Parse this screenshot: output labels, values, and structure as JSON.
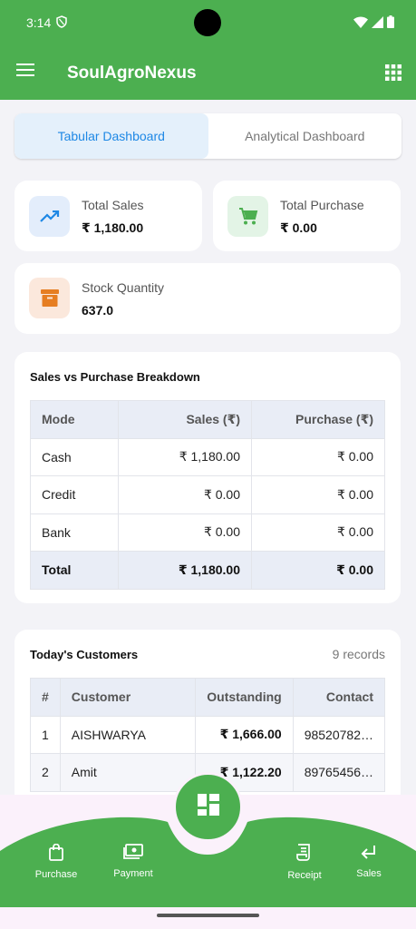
{
  "status_bar": {
    "time": "3:14"
  },
  "app": {
    "title": "SoulAgroNexus"
  },
  "tabs": [
    {
      "label": "Tabular Dashboard",
      "active": true
    },
    {
      "label": "Analytical Dashboard",
      "active": false
    }
  ],
  "stats": {
    "total_sales": {
      "label": "Total Sales",
      "value": "₹ 1,180.00",
      "icon": "trending-up-icon"
    },
    "total_purchase": {
      "label": "Total Purchase",
      "value": "₹ 0.00",
      "icon": "cart-icon"
    },
    "stock_quantity": {
      "label": "Stock Quantity",
      "value": "637.0",
      "icon": "archive-icon"
    }
  },
  "breakdown": {
    "title": "Sales vs Purchase Breakdown",
    "headers": [
      "Mode",
      "Sales (₹)",
      "Purchase (₹)"
    ],
    "rows": [
      [
        "Cash",
        "₹ 1,180.00",
        "₹ 0.00"
      ],
      [
        "Credit",
        "₹ 0.00",
        "₹ 0.00"
      ],
      [
        "Bank",
        "₹ 0.00",
        "₹ 0.00"
      ]
    ],
    "total": [
      "Total",
      "₹ 1,180.00",
      "₹ 0.00"
    ]
  },
  "customers": {
    "title": "Today's Customers",
    "records": "9 records",
    "headers": [
      "#",
      "Customer",
      "Outstanding",
      "Contact"
    ],
    "rows": [
      [
        "1",
        "AISHWARYA",
        "₹ 1,666.00",
        "98520782…"
      ],
      [
        "2",
        "Amit",
        "₹ 1,122.20",
        "89765456…"
      ]
    ]
  },
  "bottom_nav": {
    "items": [
      {
        "label": "Purchase",
        "icon": "bag-icon"
      },
      {
        "label": "Payment",
        "icon": "payment-icon"
      },
      {
        "label": "Receipt",
        "icon": "receipt-icon"
      },
      {
        "label": "Sales",
        "icon": "return-arrow-icon"
      }
    ],
    "fab_icon": "dashboard-icon"
  },
  "colors": {
    "primary": "#4caf50",
    "tab_active_bg": "#e4f0fb",
    "tab_active_text": "#1e88e5",
    "sales_icon_bg": "#e3edfb",
    "purchase_icon_bg": "#e3f4e6",
    "stock_icon_bg": "#fbe8dc",
    "stock_icon": "#e67e22"
  }
}
